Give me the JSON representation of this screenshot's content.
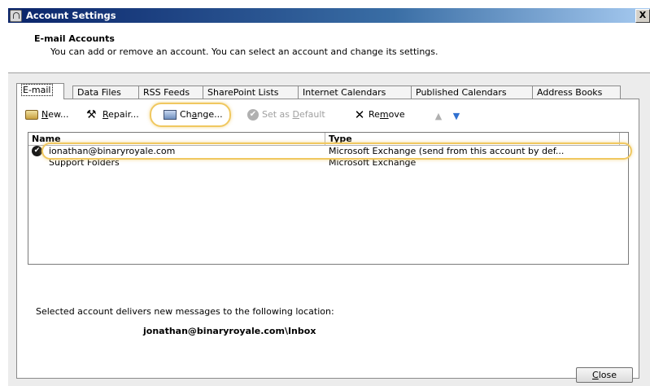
{
  "window": {
    "title": "Account Settings",
    "close_glyph": "X"
  },
  "header": {
    "title": "E-mail Accounts",
    "description": "You can add or remove an account. You can select an account and change its settings."
  },
  "tabs": [
    {
      "label": "E-mail",
      "active": true
    },
    {
      "label": "Data Files"
    },
    {
      "label": "RSS Feeds"
    },
    {
      "label": "SharePoint Lists"
    },
    {
      "label": "Internet Calendars"
    },
    {
      "label": "Published Calendars"
    },
    {
      "label": "Address Books"
    }
  ],
  "toolbar": {
    "new": {
      "pre": "",
      "key": "N",
      "post": "ew...",
      "icon": "new-account-icon"
    },
    "repair": {
      "pre": "",
      "key": "R",
      "post": "epair...",
      "icon": "repair-icon"
    },
    "change": {
      "pre": "Ch",
      "key": "a",
      "post": "nge...",
      "icon": "change-icon"
    },
    "set_default": {
      "pre": "Set as ",
      "key": "D",
      "post": "efault",
      "icon": "checkmark-circle-icon",
      "enabled": false
    },
    "remove": {
      "pre": "Re",
      "key": "m",
      "post": "ove",
      "icon": "remove-x-icon"
    },
    "move_up_icon": "up-arrow-icon",
    "move_down_icon": "down-arrow-icon"
  },
  "accounts_table": {
    "columns": [
      "Name",
      "Type"
    ],
    "rows": [
      {
        "name": "ionathan@binaryroyale.com",
        "type": "Microsoft Exchange (send from this account by def...",
        "default": true
      },
      {
        "name": "Support Folders",
        "type": "Microsoft Exchange",
        "default": false
      }
    ]
  },
  "delivery": {
    "label": "Selected account delivers new messages to the following location:",
    "location": "jonathan@binaryroyale.com\\Inbox"
  },
  "footer": {
    "close_pre": "",
    "close_key": "C",
    "close_post": "lose"
  },
  "colors": {
    "titlebar_start": "#0a246a",
    "highlight_ring": "#f0c860",
    "arrow_down": "#3070d0"
  }
}
